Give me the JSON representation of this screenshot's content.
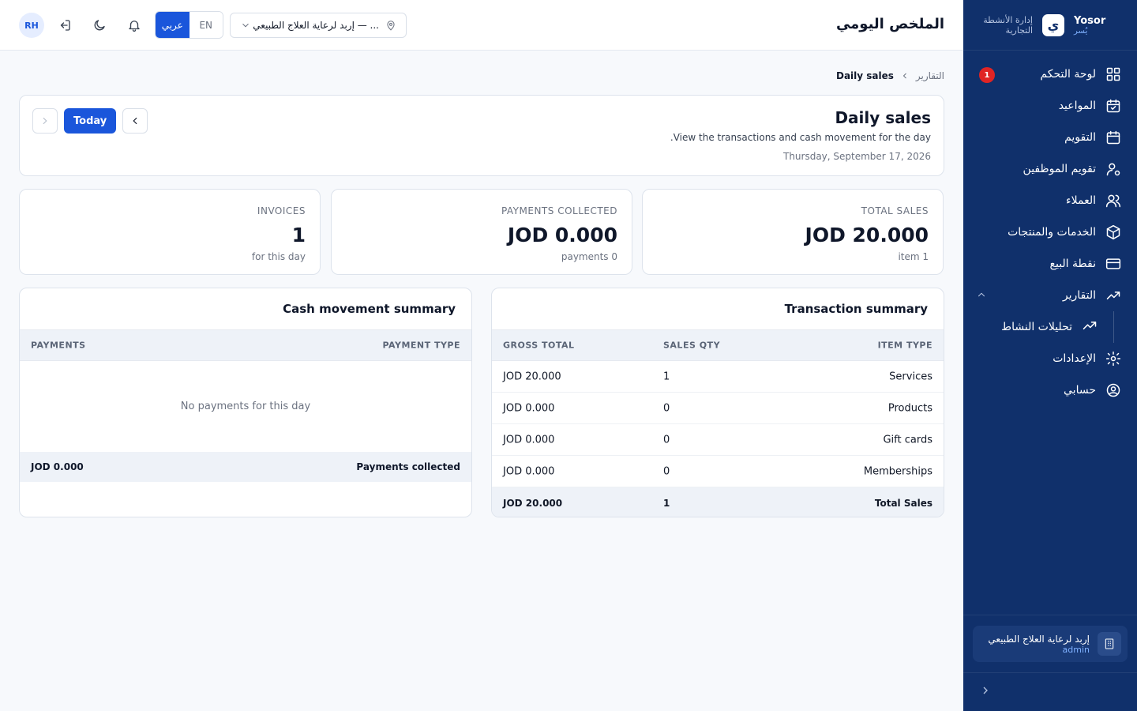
{
  "sidebar": {
    "brand_name": "Yosor",
    "brand_name_ar": "يُسر",
    "brand_tagline": "إدارة الأنشطة التجارية",
    "brand_logo_glyph": "ي",
    "items": [
      {
        "label": "لوحة التحكم",
        "icon": "dashboard-icon",
        "badge": "1"
      },
      {
        "label": "المواعيد",
        "icon": "calendar-check-icon"
      },
      {
        "label": "التقويم",
        "icon": "calendar-icon"
      },
      {
        "label": "تقويم الموظفين",
        "icon": "user-gear-icon"
      },
      {
        "label": "العملاء",
        "icon": "users-icon"
      },
      {
        "label": "الخدمات والمنتجات",
        "icon": "box-icon"
      },
      {
        "label": "نقطة البيع",
        "icon": "credit-card-icon"
      },
      {
        "label": "التقارير",
        "icon": "trending-up-icon",
        "expanded": true
      },
      {
        "label": "تحليلات النشاط",
        "icon": "trending-up-icon",
        "sub": true
      },
      {
        "label": "الإعدادات",
        "icon": "gear-icon"
      },
      {
        "label": "حسابي",
        "icon": "user-circle-icon"
      }
    ],
    "account": {
      "name": "إربد لرعاية العلاج الطبيعي",
      "role": "admin"
    }
  },
  "header": {
    "title": "الملخص اليومي",
    "avatar_initials": "RH",
    "lang_ar": "عربي",
    "lang_en": "EN",
    "location": "إربد لرعاية العلاج الطبيعي — ..."
  },
  "breadcrumb": {
    "parent": "التقارير",
    "current": "Daily sales"
  },
  "page": {
    "heading": "Daily sales",
    "description": ".View the transactions and cash movement for the day",
    "date": "Thursday, September 17, 2026",
    "today_label": "Today"
  },
  "stats": {
    "total_sales": {
      "label": "TOTAL SALES",
      "value": "JOD 20.000",
      "sub": "item 1"
    },
    "payments": {
      "label": "PAYMENTS COLLECTED",
      "value": "JOD 0.000",
      "sub": "payments 0"
    },
    "invoices": {
      "label": "INVOICES",
      "value": "1",
      "sub": "for this day"
    }
  },
  "transaction_summary": {
    "title": "Transaction summary",
    "columns": {
      "item_type": "ITEM TYPE",
      "sales_qty": "SALES QTY",
      "gross_total": "GROSS TOTAL"
    },
    "rows": [
      {
        "item_type": "Services",
        "qty": "1",
        "gross": "JOD 20.000"
      },
      {
        "item_type": "Products",
        "qty": "0",
        "gross": "JOD 0.000"
      },
      {
        "item_type": "Gift cards",
        "qty": "0",
        "gross": "JOD 0.000"
      },
      {
        "item_type": "Memberships",
        "qty": "0",
        "gross": "JOD 0.000"
      }
    ],
    "total": {
      "item_type": "Total Sales",
      "qty": "1",
      "gross": "JOD 20.000"
    }
  },
  "cash_summary": {
    "title": "Cash movement summary",
    "columns": {
      "payment_type": "PAYMENT TYPE",
      "payments": "PAYMENTS"
    },
    "empty": "No payments for this day",
    "total": {
      "label": "Payments collected",
      "value": "JOD 0.000"
    }
  },
  "colors": {
    "sidebar": "#10306b",
    "accent": "#1a56db",
    "badge": "#e02424"
  }
}
